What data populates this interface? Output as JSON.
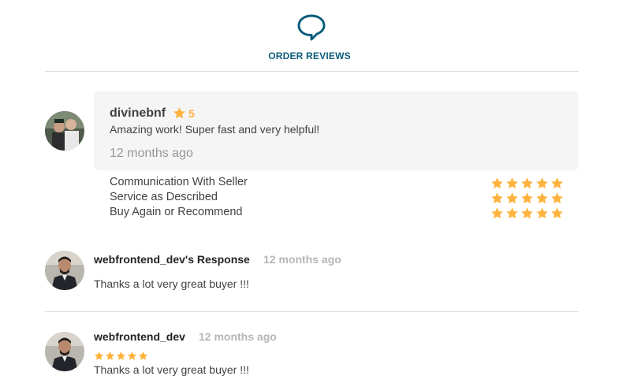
{
  "header": {
    "icon": "speech-bubble-icon",
    "title": "ORDER REVIEWS",
    "accent_color": "#0b5d7a"
  },
  "review": {
    "username": "divinebnf",
    "rating": "5",
    "text": "Amazing work! Super fast and very helpful!",
    "time_ago": "12 months ago",
    "criteria": [
      {
        "label": "Communication With Seller",
        "stars": 5
      },
      {
        "label": "Service as Described",
        "stars": 5
      },
      {
        "label": "Buy Again or Recommend",
        "stars": 5
      }
    ]
  },
  "response": {
    "name": "webfrontend_dev's Response",
    "time_ago": "12 months ago",
    "text": "Thanks a lot very great buyer !!!"
  },
  "buyer_review": {
    "name": "webfrontend_dev",
    "time_ago": "12 months ago",
    "stars": 5,
    "text": "Thanks a lot very great buyer !!!"
  },
  "colors": {
    "star": "#ffb33e",
    "muted": "#95979d"
  }
}
